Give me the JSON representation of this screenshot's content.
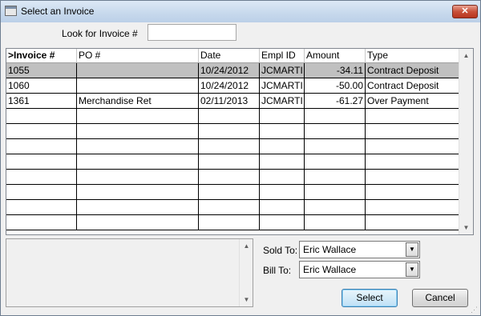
{
  "window": {
    "title": "Select an Invoice",
    "close_glyph": "✕"
  },
  "search": {
    "label": "Look for Invoice #",
    "value": ""
  },
  "table": {
    "columns": [
      ">Invoice #",
      "PO #",
      "Date",
      "Empl ID",
      "Amount",
      "Type"
    ],
    "rows": [
      {
        "invoice": "1055",
        "po": "",
        "date": "10/24/2012",
        "empl": "JCMARTI",
        "amount": "-34.11",
        "type": "Contract Deposit",
        "selected": true
      },
      {
        "invoice": "1060",
        "po": "",
        "date": "10/24/2012",
        "empl": "JCMARTI",
        "amount": "-50.00",
        "type": "Contract Deposit",
        "selected": false
      },
      {
        "invoice": "1361",
        "po": "Merchandise Ret",
        "date": "02/11/2013",
        "empl": "JCMARTI",
        "amount": "-61.27",
        "type": "Over Payment",
        "selected": false
      }
    ],
    "empty_row_count": 8
  },
  "sold_to": {
    "label": "Sold To:",
    "value": "Eric Wallace"
  },
  "bill_to": {
    "label": "Bill To:",
    "value": "Eric Wallace"
  },
  "buttons": {
    "select": "Select",
    "cancel": "Cancel"
  },
  "icons": {
    "scroll_up": "scroll-up-arrow-icon",
    "scroll_down": "scroll-down-arrow-icon",
    "dropdown": "dropdown-arrow-icon",
    "window": "window-icon",
    "resize": "resize-grip-icon"
  }
}
